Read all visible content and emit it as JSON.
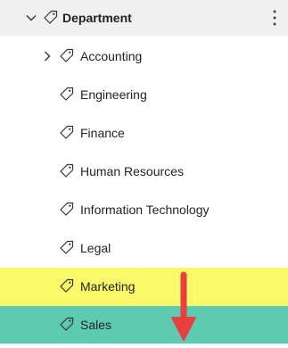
{
  "tree": {
    "header": {
      "title": "Department",
      "icon": "tag-icon",
      "expander_icon": "chevron-down-icon",
      "menu_icon": "more-vertical-icon"
    },
    "items": [
      {
        "label": "Accounting",
        "expandable": true,
        "icon": "tag-icon"
      },
      {
        "label": "Engineering",
        "icon": "tag-icon"
      },
      {
        "label": "Finance",
        "icon": "tag-icon"
      },
      {
        "label": "Human Resources",
        "icon": "tag-icon"
      },
      {
        "label": "Information Technology",
        "icon": "tag-icon"
      },
      {
        "label": "Legal",
        "icon": "tag-icon"
      },
      {
        "label": "Marketing",
        "icon": "tag-icon",
        "highlight": "#fbf86a"
      },
      {
        "label": "Sales",
        "icon": "tag-icon",
        "highlight": "#5dcbb2"
      }
    ]
  },
  "annotation": {
    "arrow_color": "#e8403f",
    "arrow_icon": "down-arrow-icon"
  }
}
